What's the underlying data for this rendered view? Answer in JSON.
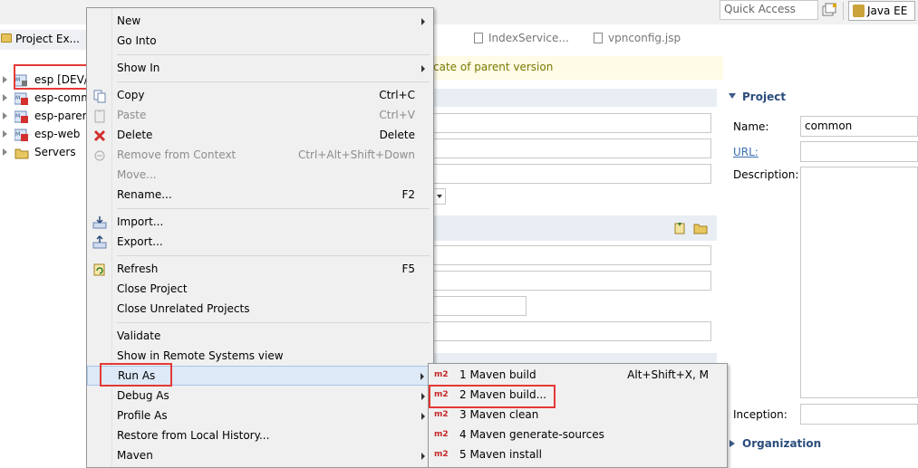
{
  "toolbar": {
    "quick_access": "Quick Access",
    "perspective": "Java EE"
  },
  "explorer": {
    "title": "Project Ex...",
    "items": [
      {
        "label": "esp [DEV/"
      },
      {
        "label": "esp-comm"
      },
      {
        "label": "esp-parer"
      },
      {
        "label": "esp-web"
      },
      {
        "label": "Servers"
      }
    ]
  },
  "editor": {
    "tabs": [
      {
        "label": "IndexService..."
      },
      {
        "label": "vpnconfig.jsp"
      }
    ],
    "message": "cate of parent version"
  },
  "context_menu": {
    "items": [
      {
        "label": "New",
        "shortcut": "",
        "submenu": true
      },
      {
        "label": "Go Into",
        "shortcut": ""
      },
      {
        "label": "Show In",
        "shortcut": "",
        "submenu": true
      },
      {
        "label": "Copy",
        "shortcut": "Ctrl+C"
      },
      {
        "label": "Paste",
        "shortcut": "Ctrl+V",
        "disabled": true
      },
      {
        "label": "Delete",
        "shortcut": "Delete"
      },
      {
        "label": "Remove from Context",
        "shortcut": "Ctrl+Alt+Shift+Down",
        "disabled": true
      },
      {
        "label": "Move...",
        "shortcut": "",
        "disabled": true
      },
      {
        "label": "Rename...",
        "shortcut": "F2"
      },
      {
        "label": "Import...",
        "shortcut": ""
      },
      {
        "label": "Export...",
        "shortcut": ""
      },
      {
        "label": "Refresh",
        "shortcut": "F5"
      },
      {
        "label": "Close Project",
        "shortcut": ""
      },
      {
        "label": "Close Unrelated Projects",
        "shortcut": ""
      },
      {
        "label": "Validate",
        "shortcut": ""
      },
      {
        "label": "Show in Remote Systems view",
        "shortcut": ""
      },
      {
        "label": "Run As",
        "shortcut": "",
        "submenu": true,
        "highlighted": true
      },
      {
        "label": "Debug As",
        "shortcut": "",
        "submenu": true
      },
      {
        "label": "Profile As",
        "shortcut": "",
        "submenu": true
      },
      {
        "label": "Restore from Local History...",
        "shortcut": ""
      },
      {
        "label": "Maven",
        "shortcut": "",
        "submenu": true
      }
    ]
  },
  "run_as_submenu": {
    "badge": "m2",
    "items": [
      {
        "label": "1 Maven build",
        "shortcut": "Alt+Shift+X, M"
      },
      {
        "label": "2 Maven build...",
        "shortcut": ""
      },
      {
        "label": "3 Maven clean",
        "shortcut": ""
      },
      {
        "label": "4 Maven generate-sources",
        "shortcut": ""
      },
      {
        "label": "5 Maven install",
        "shortcut": ""
      }
    ]
  },
  "project_panel": {
    "section_title": "Project",
    "name_label": "Name:",
    "name_value": "common",
    "url_label": "URL:",
    "description_label": "Description:",
    "inception_label": "Inception:",
    "organization_title": "Organization"
  },
  "colors": {
    "highlight_box": "#e53935",
    "menu_bg": "#f0f0f0",
    "menu_hover": "#dde9f6",
    "m2_badge": "#c62828",
    "section_title": "#2b4d7c"
  }
}
